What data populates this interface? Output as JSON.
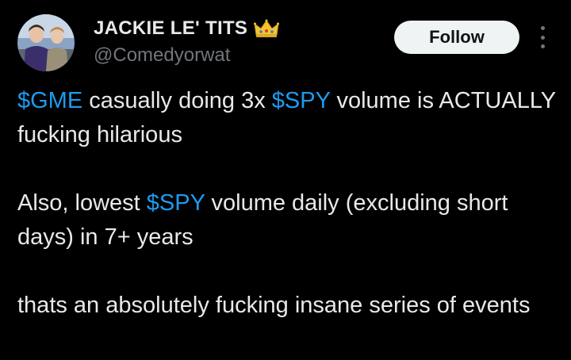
{
  "author": {
    "display_name": "JACKIE LE' TITS",
    "badge_icon": "crown-icon",
    "handle": "@Comedyorwat",
    "avatar": "avatar-photo-two-people"
  },
  "actions": {
    "follow_label": "Follow",
    "more_icon": "more-vertical-icon"
  },
  "tweet": {
    "line1": {
      "cashtag1": "$GME",
      "text1": " casually doing 3x ",
      "cashtag2": "$SPY",
      "text2": " volume is ACTUALLY fucking hilarious"
    },
    "line2": {
      "text1": "Also, lowest ",
      "cashtag1": "$SPY",
      "text2": " volume daily (excluding short days) in 7+ years"
    },
    "line3": {
      "text1": "thats an absolutely fucking insane series of events"
    }
  },
  "colors": {
    "background": "#000000",
    "text": "#e7e9ea",
    "secondary_text": "#71767b",
    "cashtag": "#1d9bf0",
    "follow_bg": "#eff3f4",
    "follow_text": "#0f1419",
    "crown": "#f4c430"
  }
}
